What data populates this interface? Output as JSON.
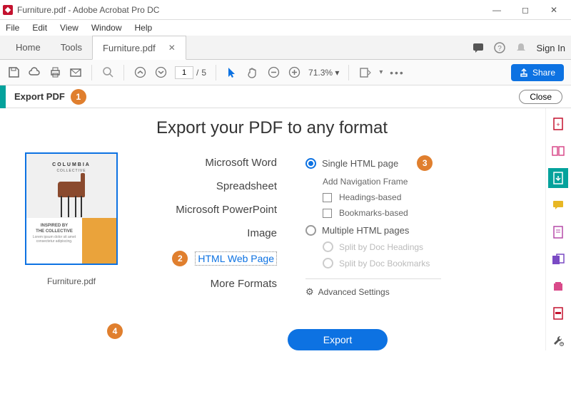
{
  "window": {
    "title": "Furniture.pdf - Adobe Acrobat Pro DC"
  },
  "menubar": [
    "File",
    "Edit",
    "View",
    "Window",
    "Help"
  ],
  "tabs": {
    "home": "Home",
    "tools": "Tools",
    "doc": "Furniture.pdf"
  },
  "header_right": {
    "sign_in": "Sign In"
  },
  "page_nav": {
    "current": "1",
    "sep": "/",
    "total": "5"
  },
  "zoom": "71.3%",
  "share_btn": "Share",
  "subbar": {
    "label": "Export PDF",
    "badge": "1",
    "close": "Close"
  },
  "heading": "Export your PDF to any format",
  "thumb": {
    "logo": "COLUMBIA",
    "sublogo": "COLLECTIVE",
    "filename": "Furniture.pdf"
  },
  "formats": {
    "word": "Microsoft Word",
    "sheet": "Spreadsheet",
    "ppt": "Microsoft PowerPoint",
    "image": "Image",
    "html": "HTML Web Page",
    "more": "More Formats"
  },
  "badges": {
    "two": "2",
    "three": "3",
    "four": "4"
  },
  "options": {
    "single": "Single HTML page",
    "add_nav": "Add Navigation Frame",
    "head_based": "Headings-based",
    "bm_based": "Bookmarks-based",
    "multi": "Multiple HTML pages",
    "split_head": "Split by Doc Headings",
    "split_bm": "Split by Doc Bookmarks",
    "advanced": "Advanced Settings"
  },
  "export_btn": "Export"
}
